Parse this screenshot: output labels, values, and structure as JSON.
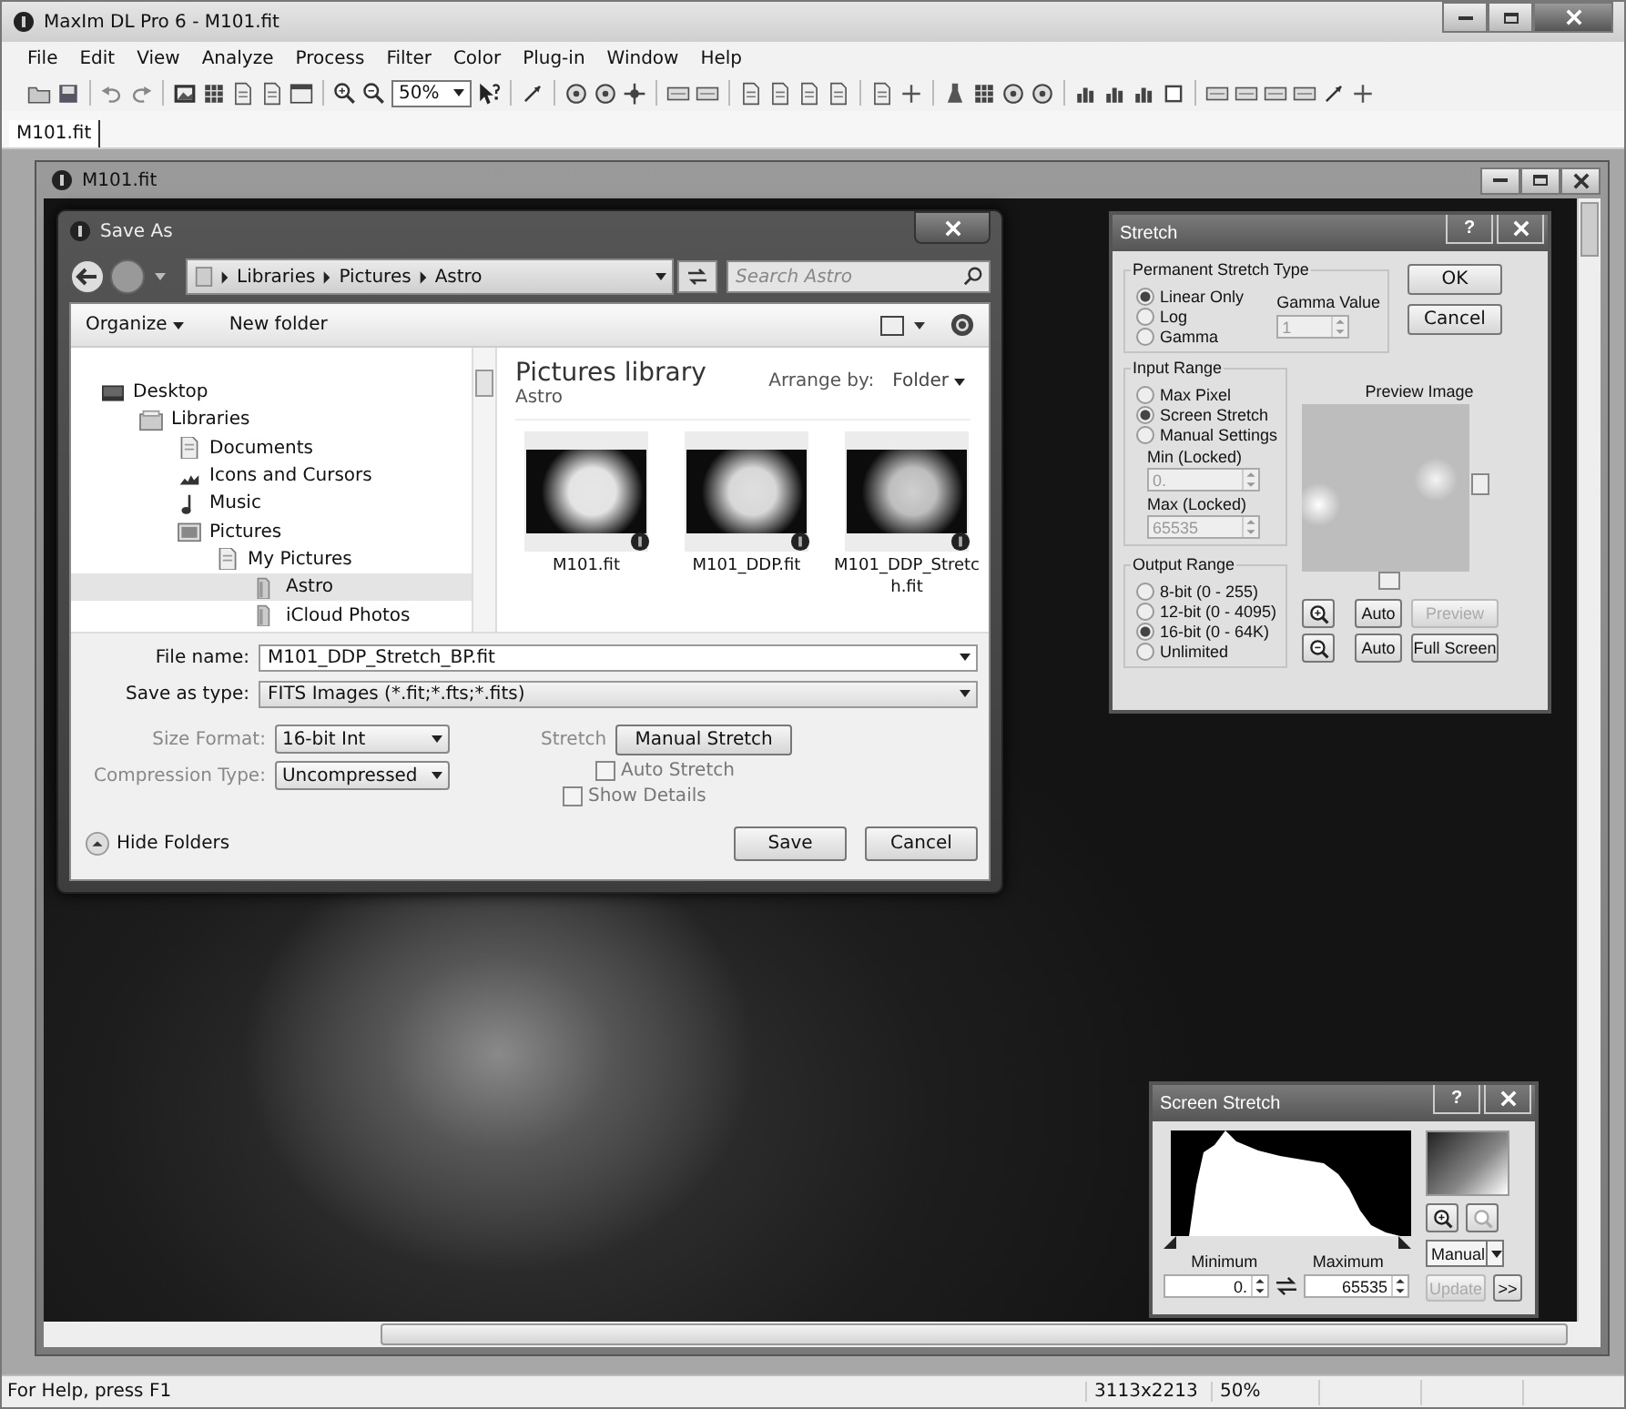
{
  "window": {
    "title": "MaxIm DL Pro 6 - M101.fit"
  },
  "menu": [
    "File",
    "Edit",
    "View",
    "Analyze",
    "Process",
    "Filter",
    "Color",
    "Plug-in",
    "Window",
    "Help"
  ],
  "toolbar": {
    "zoom": "50%"
  },
  "document_tabs": [
    {
      "label": "M101.fit",
      "selected": true
    }
  ],
  "image_window": {
    "title": "M101.fit"
  },
  "save_as": {
    "title": "Save As",
    "address": [
      "Libraries",
      "Pictures",
      "Astro"
    ],
    "search": {
      "placeholder": "Search Astro"
    },
    "commands": [
      "Organize",
      "New folder"
    ],
    "nav": [
      {
        "label": "Desktop",
        "kind": "desktop",
        "selected": false,
        "children": [
          {
            "label": "Libraries",
            "kind": "library",
            "selected": false,
            "children": [
              {
                "label": "Documents",
                "kind": "document",
                "selected": false
              },
              {
                "label": "Icons and Cursors",
                "kind": "cursor",
                "selected": false
              },
              {
                "label": "Music",
                "kind": "music",
                "selected": false
              },
              {
                "label": "Pictures",
                "kind": "picture",
                "selected": false,
                "children": [
                  {
                    "label": "My Pictures",
                    "kind": "document",
                    "selected": false,
                    "children": [
                      {
                        "label": "Astro",
                        "kind": "folder",
                        "selected": true
                      },
                      {
                        "label": "iCloud Photos",
                        "kind": "folder",
                        "selected": false
                      }
                    ]
                  }
                ]
              }
            ]
          }
        ]
      }
    ],
    "library_title": "Pictures library",
    "library_subtitle": "Astro",
    "arrange_label": "Arrange by:",
    "arrange_value": "Folder",
    "files": [
      {
        "name": "M101.fit"
      },
      {
        "name": "M101_DDP.fit"
      },
      {
        "name": "M101_DDP_Stretch.fit"
      }
    ],
    "file_name_label": "File name:",
    "file_name": "M101_DDP_Stretch_BP.fit",
    "type_label": "Save as type:",
    "type": "FITS Images (*.fit;*.fts;*.fits)",
    "size_format_label": "Size Format:",
    "size_format": "16-bit Int",
    "compression_label": "Compression Type:",
    "compression": "Uncompressed",
    "stretch_label": "Stretch",
    "stretch_button": "Manual Stretch",
    "checks": [
      {
        "label": "Auto Stretch",
        "checked": false
      },
      {
        "label": "Show Details",
        "checked": false
      }
    ],
    "hide_folders": "Hide Folders",
    "buttons": [
      "Save",
      "Cancel"
    ]
  },
  "stretch": {
    "title": "Stretch",
    "help": "?",
    "type_group": "Permanent Stretch Type",
    "types": [
      {
        "label": "Linear Only",
        "selected": true
      },
      {
        "label": "Log",
        "selected": false
      },
      {
        "label": "Gamma",
        "selected": false
      }
    ],
    "gamma_label": "Gamma Value",
    "gamma": "1",
    "ok": "OK",
    "cancel": "Cancel",
    "input_group": "Input Range",
    "inputs": [
      {
        "label": "Max Pixel",
        "selected": false
      },
      {
        "label": "Screen Stretch",
        "selected": true
      },
      {
        "label": "Manual Settings",
        "selected": false
      }
    ],
    "min_label": "Min (Locked)",
    "min": "0.",
    "max_label": "Max (Locked)",
    "max": "65535",
    "output_group": "Output Range",
    "outputs": [
      {
        "label": "8-bit (0 - 255)",
        "selected": false
      },
      {
        "label": "12-bit (0 - 4095)",
        "selected": false
      },
      {
        "label": "16-bit (0 - 64K)",
        "selected": true
      },
      {
        "label": "Unlimited",
        "selected": false
      }
    ],
    "preview_label": "Preview Image",
    "auto": [
      "Auto",
      "Auto"
    ],
    "preview_button": {
      "label": "Preview",
      "disabled": true
    },
    "full_screen": "Full Screen"
  },
  "screen_stretch": {
    "title": "Screen Stretch",
    "help": "?",
    "mode": "Manual",
    "min_label": "Minimum",
    "max_label": "Maximum",
    "min": "0.",
    "max": "65535",
    "update": {
      "label": "Update",
      "disabled": true
    },
    "more": ">>"
  },
  "status_bar": {
    "help": "For Help, press F1",
    "size": "3113x2213",
    "zoom": "50%"
  }
}
